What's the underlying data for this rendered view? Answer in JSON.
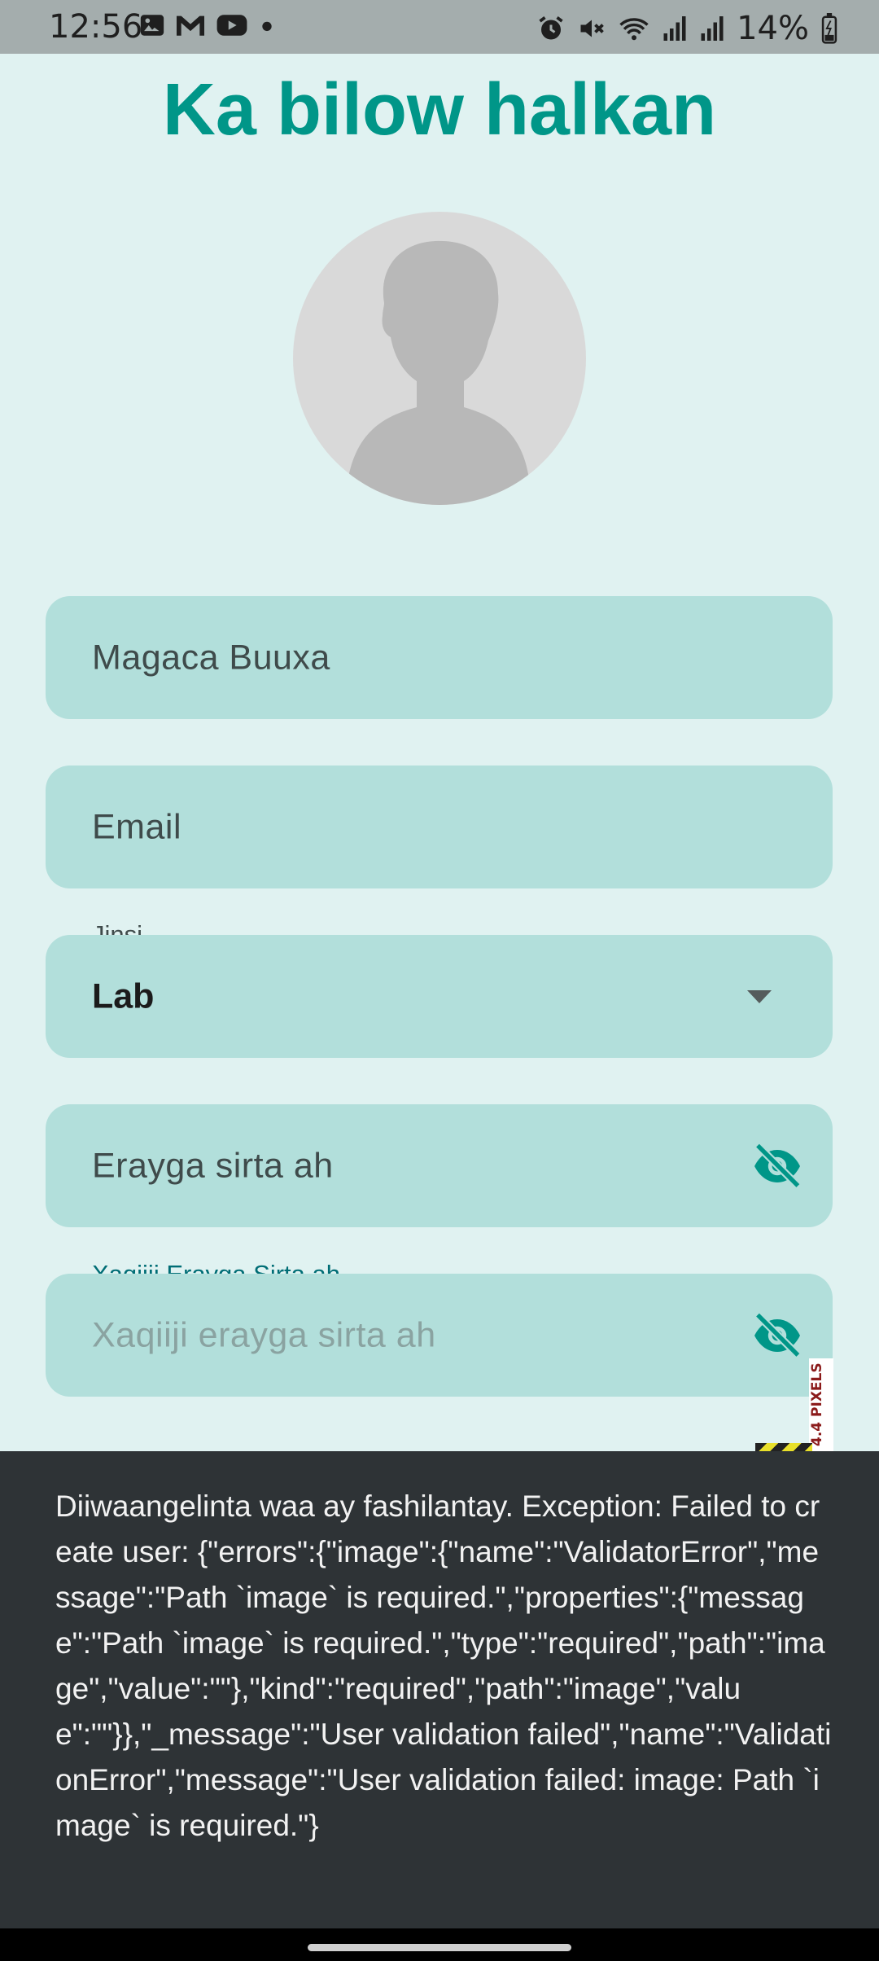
{
  "status_bar": {
    "time": "12:56",
    "battery_percent": "14%",
    "left_icons": [
      "gallery-icon",
      "gmail-icon",
      "youtube-icon",
      "dot-icon"
    ],
    "right_icons": [
      "alarm-icon",
      "mute-icon",
      "wifi-icon",
      "signal-icon",
      "signal-icon",
      "battery-icon"
    ]
  },
  "page": {
    "title": "Ka bilow halkan"
  },
  "form": {
    "full_name_placeholder": "Magaca Buuxa",
    "email_placeholder": "Email",
    "gender_label": "Jinsi",
    "gender_value": "Lab",
    "password_placeholder": "Erayga sirta ah",
    "confirm_password_label": "Xaqiiji Erayga Sirta ah",
    "confirm_password_placeholder": "Xaqiiji erayga sirta ah"
  },
  "snackbar": {
    "message": "Diiwaangelinta waa ay fashilantay. Exception: Failed to create user: {\"errors\":{\"image\":{\"name\":\"ValidatorError\",\"message\":\"Path `image` is required.\",\"properties\":{\"message\":\"Path `image` is required.\",\"type\":\"required\",\"path\":\"image\",\"value\":\"\"},\"kind\":\"required\",\"path\":\"image\",\"value\":\"\"}},\"_message\":\"User validation failed\",\"name\":\"ValidationError\",\"message\":\"User validation failed: image: Path `image` is required.\"}"
  },
  "debug_overlay": {
    "label": "4.4 PIXELS"
  },
  "colors": {
    "accent": "#009688",
    "background": "#e0f2f1",
    "field_fill": "#b2dfdb",
    "snackbar": "#2e3336"
  }
}
